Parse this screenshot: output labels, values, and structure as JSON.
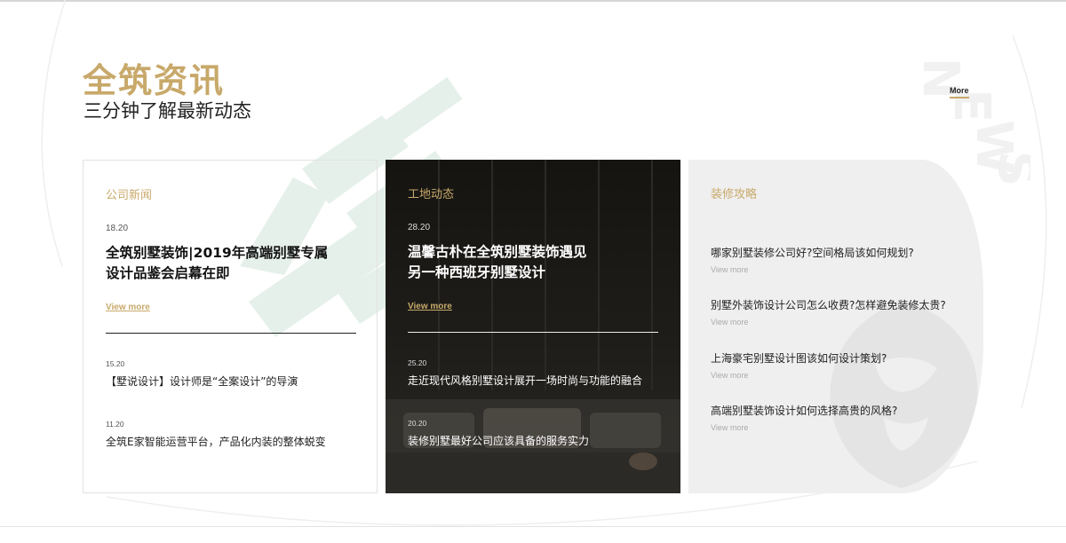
{
  "section": {
    "title": "全筑资讯",
    "subtitle": "三分钟了解最新动态",
    "more_label": "More",
    "decor_letters": [
      "N",
      "E",
      "W",
      "S"
    ],
    "accent_color": "#c8a96a"
  },
  "cards": [
    {
      "title": "公司新闻",
      "featured": {
        "date": "18.20",
        "headline_line1": "全筑别墅装饰|2019年高端别墅专属",
        "headline_line2": "设计品鉴会启幕在即",
        "view_more": "View more"
      },
      "items": [
        {
          "date": "15.20",
          "title": "【墅说设计】设计师是“全案设计”的导演"
        },
        {
          "date": "11.20",
          "title": "全筑E家智能运营平台，产品化内装的整体蜕变"
        }
      ]
    },
    {
      "title": "工地动态",
      "featured": {
        "date": "28.20",
        "headline_line1": "温馨古朴在全筑别墅装饰遇见",
        "headline_line2": "另一种西班牙别墅设计",
        "view_more": "View more"
      },
      "items": [
        {
          "date": "25.20",
          "title": "走近现代风格别墅设计展开一场时尚与功能的融合"
        },
        {
          "date": "20.20",
          "title": "装修别墅最好公司应该具备的服务实力"
        }
      ]
    },
    {
      "title": "装修攻略",
      "items": [
        {
          "title": "哪家别墅装修公司好?空间格局该如何规划?",
          "view_more": "View more"
        },
        {
          "title": "别墅外装饰设计公司怎么收费?怎样避免装修太贵?",
          "view_more": "View more"
        },
        {
          "title": "上海豪宅别墅设计图该如何设计策划?",
          "view_more": "View more"
        },
        {
          "title": "高端别墅装饰设计如何选择高贵的风格?",
          "view_more": "View more"
        }
      ]
    }
  ]
}
